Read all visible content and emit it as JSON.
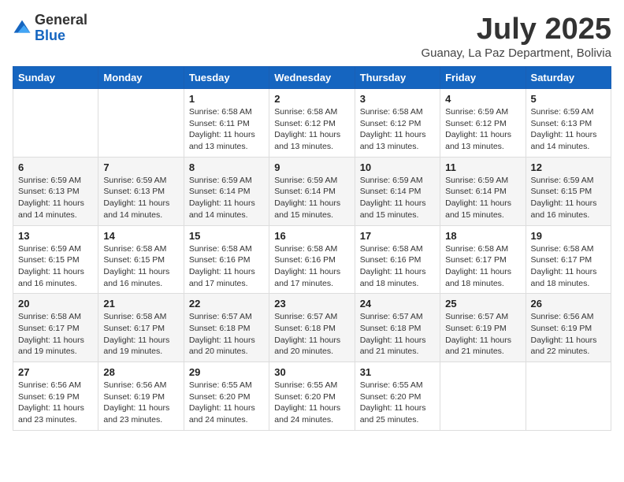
{
  "logo": {
    "general": "General",
    "blue": "Blue"
  },
  "header": {
    "month": "July 2025",
    "location": "Guanay, La Paz Department, Bolivia"
  },
  "weekdays": [
    "Sunday",
    "Monday",
    "Tuesday",
    "Wednesday",
    "Thursday",
    "Friday",
    "Saturday"
  ],
  "weeks": [
    [
      {
        "day": "",
        "info": ""
      },
      {
        "day": "",
        "info": ""
      },
      {
        "day": "1",
        "info": "Sunrise: 6:58 AM\nSunset: 6:11 PM\nDaylight: 11 hours and 13 minutes."
      },
      {
        "day": "2",
        "info": "Sunrise: 6:58 AM\nSunset: 6:12 PM\nDaylight: 11 hours and 13 minutes."
      },
      {
        "day": "3",
        "info": "Sunrise: 6:58 AM\nSunset: 6:12 PM\nDaylight: 11 hours and 13 minutes."
      },
      {
        "day": "4",
        "info": "Sunrise: 6:59 AM\nSunset: 6:12 PM\nDaylight: 11 hours and 13 minutes."
      },
      {
        "day": "5",
        "info": "Sunrise: 6:59 AM\nSunset: 6:13 PM\nDaylight: 11 hours and 14 minutes."
      }
    ],
    [
      {
        "day": "6",
        "info": "Sunrise: 6:59 AM\nSunset: 6:13 PM\nDaylight: 11 hours and 14 minutes."
      },
      {
        "day": "7",
        "info": "Sunrise: 6:59 AM\nSunset: 6:13 PM\nDaylight: 11 hours and 14 minutes."
      },
      {
        "day": "8",
        "info": "Sunrise: 6:59 AM\nSunset: 6:14 PM\nDaylight: 11 hours and 14 minutes."
      },
      {
        "day": "9",
        "info": "Sunrise: 6:59 AM\nSunset: 6:14 PM\nDaylight: 11 hours and 15 minutes."
      },
      {
        "day": "10",
        "info": "Sunrise: 6:59 AM\nSunset: 6:14 PM\nDaylight: 11 hours and 15 minutes."
      },
      {
        "day": "11",
        "info": "Sunrise: 6:59 AM\nSunset: 6:14 PM\nDaylight: 11 hours and 15 minutes."
      },
      {
        "day": "12",
        "info": "Sunrise: 6:59 AM\nSunset: 6:15 PM\nDaylight: 11 hours and 16 minutes."
      }
    ],
    [
      {
        "day": "13",
        "info": "Sunrise: 6:59 AM\nSunset: 6:15 PM\nDaylight: 11 hours and 16 minutes."
      },
      {
        "day": "14",
        "info": "Sunrise: 6:58 AM\nSunset: 6:15 PM\nDaylight: 11 hours and 16 minutes."
      },
      {
        "day": "15",
        "info": "Sunrise: 6:58 AM\nSunset: 6:16 PM\nDaylight: 11 hours and 17 minutes."
      },
      {
        "day": "16",
        "info": "Sunrise: 6:58 AM\nSunset: 6:16 PM\nDaylight: 11 hours and 17 minutes."
      },
      {
        "day": "17",
        "info": "Sunrise: 6:58 AM\nSunset: 6:16 PM\nDaylight: 11 hours and 18 minutes."
      },
      {
        "day": "18",
        "info": "Sunrise: 6:58 AM\nSunset: 6:17 PM\nDaylight: 11 hours and 18 minutes."
      },
      {
        "day": "19",
        "info": "Sunrise: 6:58 AM\nSunset: 6:17 PM\nDaylight: 11 hours and 18 minutes."
      }
    ],
    [
      {
        "day": "20",
        "info": "Sunrise: 6:58 AM\nSunset: 6:17 PM\nDaylight: 11 hours and 19 minutes."
      },
      {
        "day": "21",
        "info": "Sunrise: 6:58 AM\nSunset: 6:17 PM\nDaylight: 11 hours and 19 minutes."
      },
      {
        "day": "22",
        "info": "Sunrise: 6:57 AM\nSunset: 6:18 PM\nDaylight: 11 hours and 20 minutes."
      },
      {
        "day": "23",
        "info": "Sunrise: 6:57 AM\nSunset: 6:18 PM\nDaylight: 11 hours and 20 minutes."
      },
      {
        "day": "24",
        "info": "Sunrise: 6:57 AM\nSunset: 6:18 PM\nDaylight: 11 hours and 21 minutes."
      },
      {
        "day": "25",
        "info": "Sunrise: 6:57 AM\nSunset: 6:19 PM\nDaylight: 11 hours and 21 minutes."
      },
      {
        "day": "26",
        "info": "Sunrise: 6:56 AM\nSunset: 6:19 PM\nDaylight: 11 hours and 22 minutes."
      }
    ],
    [
      {
        "day": "27",
        "info": "Sunrise: 6:56 AM\nSunset: 6:19 PM\nDaylight: 11 hours and 23 minutes."
      },
      {
        "day": "28",
        "info": "Sunrise: 6:56 AM\nSunset: 6:19 PM\nDaylight: 11 hours and 23 minutes."
      },
      {
        "day": "29",
        "info": "Sunrise: 6:55 AM\nSunset: 6:20 PM\nDaylight: 11 hours and 24 minutes."
      },
      {
        "day": "30",
        "info": "Sunrise: 6:55 AM\nSunset: 6:20 PM\nDaylight: 11 hours and 24 minutes."
      },
      {
        "day": "31",
        "info": "Sunrise: 6:55 AM\nSunset: 6:20 PM\nDaylight: 11 hours and 25 minutes."
      },
      {
        "day": "",
        "info": ""
      },
      {
        "day": "",
        "info": ""
      }
    ]
  ]
}
